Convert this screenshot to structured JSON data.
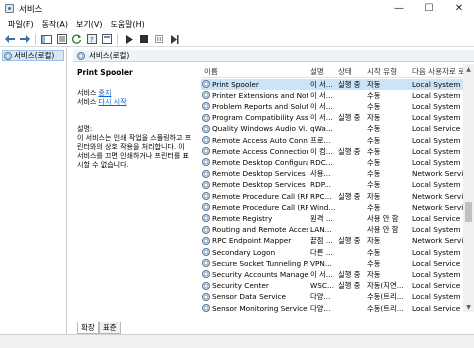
{
  "window": {
    "title": "서비스",
    "controls": [
      "—",
      "☐",
      "✕"
    ]
  },
  "menu": [
    "파일(F)",
    "동작(A)",
    "보기(V)",
    "도움말(H)"
  ],
  "tree": {
    "selected_label": "서비스(로컬)"
  },
  "pane": {
    "header": "서비스(로컬)"
  },
  "details": {
    "service_name": "Print Spooler",
    "actions": [
      {
        "prefix": "서비스 ",
        "link": "중지"
      },
      {
        "prefix": "서비스 ",
        "link": "다시 시작"
      }
    ],
    "description_label": "설명:",
    "description_text": "이 서비스는 인쇄 작업을 스풀링하고 프린터와의 상호 작용을 처리합니다. 이 서비스를 끄면 인쇄하거나 프린터를 표시할 수 없습니다."
  },
  "list": {
    "columns": [
      "이름",
      "설명",
      "상태",
      "시작 유형",
      "다음 사용자로 로"
    ],
    "rows": [
      {
        "name": "Print Spooler",
        "desc": "이 서...",
        "status": "실행 중",
        "startup": "자동",
        "logon": "Local System",
        "selected": true
      },
      {
        "name": "Printer Extensions and Notifi...",
        "desc": "이 서...",
        "status": "",
        "startup": "수동",
        "logon": "Local System"
      },
      {
        "name": "Problem Reports and Soluti...",
        "desc": "이 서...",
        "status": "",
        "startup": "수동",
        "logon": "Local System"
      },
      {
        "name": "Program Compatibility Assi...",
        "desc": "이 서...",
        "status": "실행 중",
        "startup": "자동",
        "logon": "Local System"
      },
      {
        "name": "Quality Windows Audio Vi...",
        "desc": "qWa...",
        "status": "",
        "startup": "수동",
        "logon": "Local Service"
      },
      {
        "name": "Remote Access Auto Conne...",
        "desc": "프로...",
        "status": "",
        "startup": "수동",
        "logon": "Local System"
      },
      {
        "name": "Remote Access Connection...",
        "desc": "이 컴...",
        "status": "실행 중",
        "startup": "수동",
        "logon": "Local System"
      },
      {
        "name": "Remote Desktop Configura...",
        "desc": "RDC...",
        "status": "",
        "startup": "수동",
        "logon": "Local System"
      },
      {
        "name": "Remote Desktop Services",
        "desc": "사용...",
        "status": "",
        "startup": "수동",
        "logon": "Network Service"
      },
      {
        "name": "Remote Desktop Services ...",
        "desc": "RDP...",
        "status": "",
        "startup": "수동",
        "logon": "Local System"
      },
      {
        "name": "Remote Procedure Call (RP...",
        "desc": "RPC...",
        "status": "실행 중",
        "startup": "자동",
        "logon": "Network Service"
      },
      {
        "name": "Remote Procedure Call (RP...",
        "desc": "Wind...",
        "status": "",
        "startup": "수동",
        "logon": "Network Service"
      },
      {
        "name": "Remote Registry",
        "desc": "원격 ...",
        "status": "",
        "startup": "사용 안 함",
        "logon": "Local Service"
      },
      {
        "name": "Routing and Remote Access",
        "desc": "LAN...",
        "status": "",
        "startup": "사용 안 함",
        "logon": "Local System"
      },
      {
        "name": "RPC Endpoint Mapper",
        "desc": "끝점 ...",
        "status": "실행 중",
        "startup": "자동",
        "logon": "Network Service"
      },
      {
        "name": "Secondary Logon",
        "desc": "다른 ...",
        "status": "",
        "startup": "수동",
        "logon": "Local System"
      },
      {
        "name": "Secure Socket Tunneling P...",
        "desc": "VPN...",
        "status": "",
        "startup": "수동",
        "logon": "Local Service"
      },
      {
        "name": "Security Accounts Manager",
        "desc": "이 서...",
        "status": "실행 중",
        "startup": "자동",
        "logon": "Local System"
      },
      {
        "name": "Security Center",
        "desc": "WSC...",
        "status": "실행 중",
        "startup": "자동(지연...",
        "logon": "Local Service"
      },
      {
        "name": "Sensor Data Service",
        "desc": "다양...",
        "status": "",
        "startup": "수동(트리...",
        "logon": "Local System"
      },
      {
        "name": "Sensor Monitoring Service",
        "desc": "다양...",
        "status": "",
        "startup": "수동(트리...",
        "logon": "Local Service"
      }
    ]
  },
  "tabs": [
    "확장",
    "표준"
  ]
}
